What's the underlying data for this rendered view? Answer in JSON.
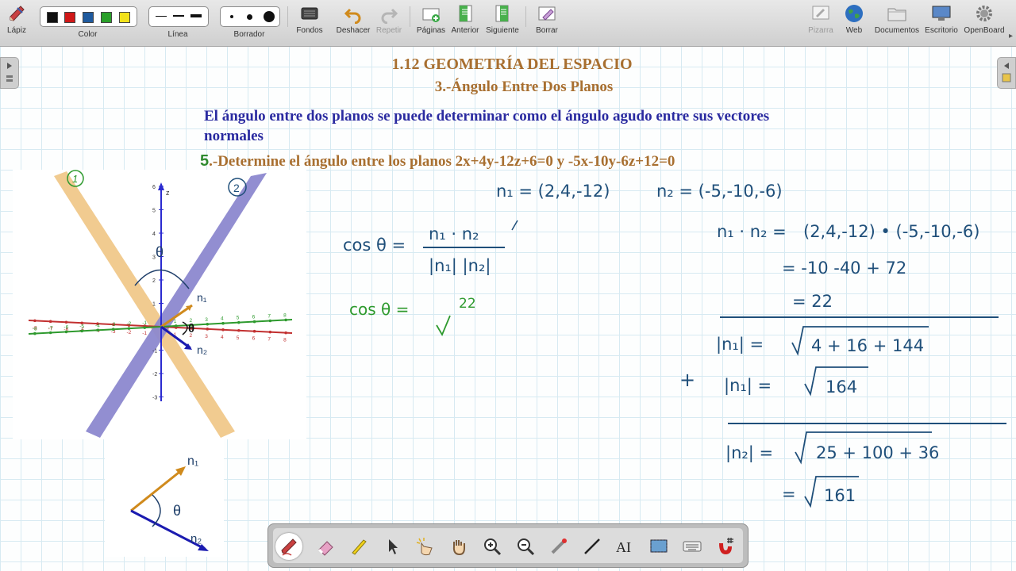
{
  "toolbar": {
    "tools": [
      {
        "label": "Lápiz",
        "icon": "pencil-icon"
      },
      {
        "label": "Color",
        "icon": "color-swatches"
      },
      {
        "label": "Línea",
        "icon": "line-width-options"
      },
      {
        "label": "Borrador",
        "icon": "eraser-size-options"
      },
      {
        "label": "Fondos",
        "icon": "backgrounds-icon"
      },
      {
        "label": "Deshacer",
        "icon": "undo-icon"
      },
      {
        "label": "Repetir",
        "icon": "redo-icon"
      },
      {
        "label": "Páginas",
        "icon": "pages-icon"
      },
      {
        "label": "Anterior",
        "icon": "previous-page-icon"
      },
      {
        "label": "Siguiente",
        "icon": "next-page-icon"
      },
      {
        "label": "Borrar",
        "icon": "clear-page-icon"
      },
      {
        "label": "Pizarra",
        "icon": "board-icon"
      },
      {
        "label": "Web",
        "icon": "globe-icon"
      },
      {
        "label": "Documentos",
        "icon": "folder-icon"
      },
      {
        "label": "Escritorio",
        "icon": "desktop-icon"
      },
      {
        "label": "OpenBoard",
        "icon": "gear-icon"
      }
    ],
    "colors": [
      "#111111",
      "#d01818",
      "#1f5a9e",
      "#2aa02a",
      "#f2e21a"
    ]
  },
  "board": {
    "title": "1.12 GEOMETRÍA DEL ESPACIO",
    "subtitle": "3.-Ángulo Entre Dos Planos",
    "intro": "El ángulo entre dos planos se puede determinar como el ángulo agudo entre sus vectores normales",
    "exercise_number": "5",
    "exercise_text": ".-Determine el ángulo entre los planos 2x+4y-12z+6=0  y  -5x-10y-6z+12=0"
  },
  "graph": {
    "plane_labels": [
      "1",
      "2"
    ],
    "axis_label_z": "z",
    "z_ticks": [
      "6",
      "5",
      "4",
      "3",
      "2",
      "1",
      "-1",
      "-2",
      "-3"
    ],
    "red_axis_ticks": [
      "-8",
      "-7",
      "-6",
      "-5",
      "-4",
      "-3",
      "-2",
      "-1",
      "1",
      "2",
      "3",
      "4",
      "5",
      "6",
      "7",
      "8"
    ],
    "green_axis_ticks": [
      "-8",
      "-7",
      "-6",
      "-5",
      "-4",
      "-3",
      "-2",
      "-1",
      "1",
      "2",
      "3",
      "4",
      "5",
      "6",
      "7",
      "8"
    ],
    "theta": "θ",
    "n1": "n₁",
    "n2": "n₂"
  },
  "handwriting": {
    "n1_def": "n₁ = (2,4,-12)",
    "n2_def": "n₂ = (-5,-10,-6)",
    "cos_formula_lhs": "cos θ =",
    "cos_formula_num": "n₁ · n₂",
    "cos_formula_den": "|n₁| |n₂|",
    "cos_value_lhs": "cos θ =",
    "cos_value_num": "22",
    "dot_lhs": "n₁ · n₂ =",
    "dot_rhs": "(2,4,-12) • (-5,-10,-6)",
    "dot_step2": "= -10  -40 + 72",
    "dot_result": "= 22",
    "norm1_lhs": "|n₁| =",
    "norm1_rad": "4 + 16 + 144",
    "norm1b_lhs": "|n₁| =",
    "norm1b_rad": "164",
    "norm2_lhs": "|n₂| =",
    "norm2_rad": "25 + 100 + 36",
    "norm2b_lhs": "=",
    "norm2b_rad": "161",
    "plus_sign": "+"
  },
  "bottom_tools": [
    "pen-tool-icon",
    "eraser-tool-icon",
    "highlighter-tool-icon",
    "pointer-tool-icon",
    "interact-tool-icon",
    "hand-tool-icon",
    "zoom-in-icon",
    "zoom-out-icon",
    "laser-pointer-icon",
    "line-tool-icon",
    "text-tool-icon",
    "capture-tool-icon",
    "keyboard-icon",
    "magnet-icon"
  ]
}
